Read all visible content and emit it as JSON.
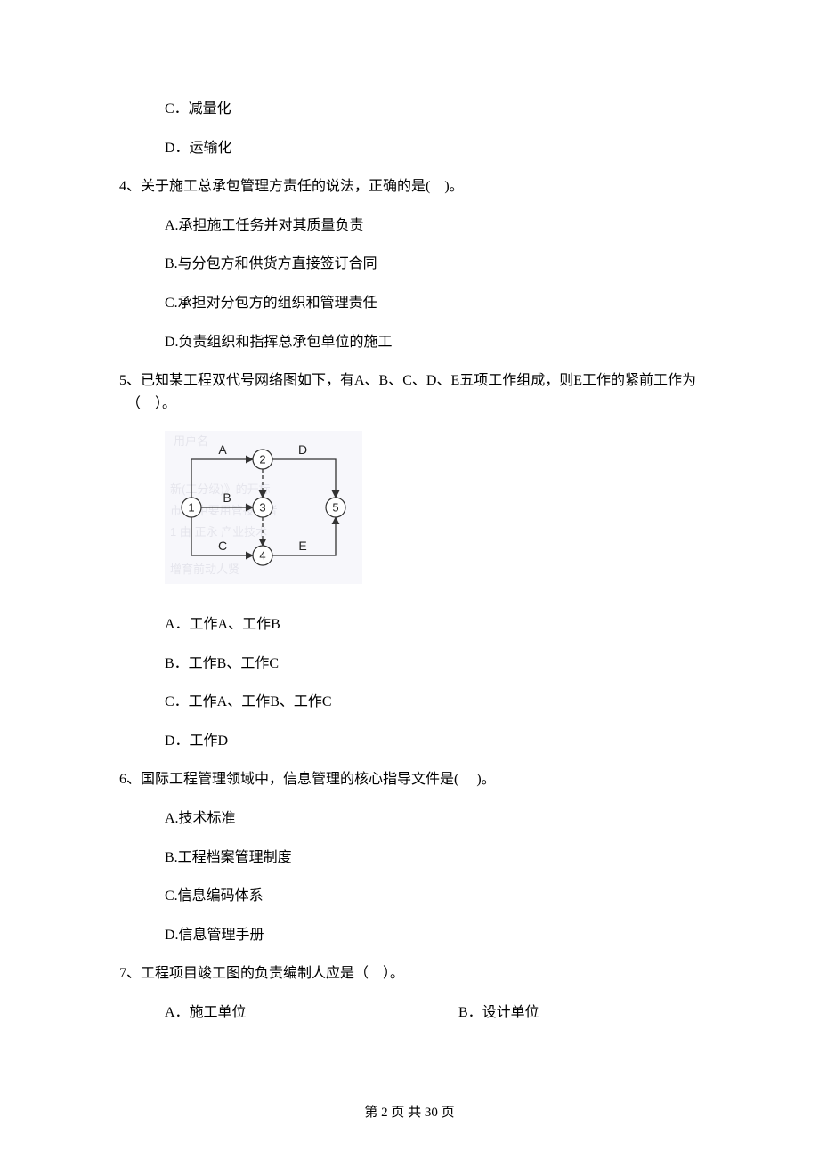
{
  "q3": {
    "opt_c": "C．减量化",
    "opt_d": "D．运输化"
  },
  "q4": {
    "stem": "4、关于施工总承包管理方责任的说法，正确的是(　)。",
    "opt_a": "A.承担施工任务并对其质量负责",
    "opt_b": "B.与分包方和供货方直接签订合同",
    "opt_c": "C.承担对分包方的组织和管理责任",
    "opt_d": "D.负责组织和指挥总承包单位的施工"
  },
  "q5": {
    "stem": "5、已知某工程双代号网络图如下，有A、B、C、D、E五项工作组成，则E工作的紧前工作为（　）。",
    "opt_a": "A．工作A、工作B",
    "opt_b": "B．工作B、工作C",
    "opt_c": "C．工作A、工作B、工作C",
    "opt_d": "D．工作D",
    "diagram": {
      "nodes": {
        "n1": "1",
        "n2": "2",
        "n3": "3",
        "n4": "4",
        "n5": "5"
      },
      "edges": {
        "A": "A",
        "B": "B",
        "C": "C",
        "D": "D",
        "E": "E"
      }
    }
  },
  "q6": {
    "stem": "6、国际工程管理领域中，信息管理的核心指导文件是(　 )。",
    "opt_a": "A.技术标准",
    "opt_b": "B.工程档案管理制度",
    "opt_c": "C.信息编码体系",
    "opt_d": "D.信息管理手册"
  },
  "q7": {
    "stem": "7、工程项目竣工图的负责编制人应是（　）。",
    "opt_a": "A．施工单位",
    "opt_b": "B．设计单位"
  },
  "footer": "第 2 页 共 30 页"
}
